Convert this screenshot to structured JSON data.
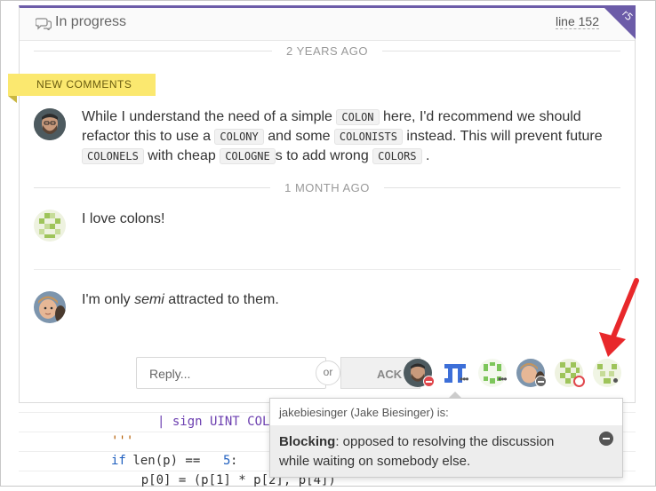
{
  "header": {
    "status": "In progress",
    "line_ref": "line 152",
    "corner": "r5",
    "status_icon": "speech-bubbles-icon"
  },
  "dividers": [
    "2 YEARS AGO",
    "1 MONTH AGO"
  ],
  "new_comments_label": "NEW COMMENTS",
  "comments": [
    {
      "avatar": "bearded-man-photo",
      "segments": {
        "t1": "While I understand the need of a simple ",
        "c1": "COLON",
        "t2": " here, I'd recommend we should refactor this to use a ",
        "c2": "COLONY",
        "t3": " and some ",
        "c3": "COLONISTS",
        "t4": " instead. This will prevent future ",
        "c4": "COLONELS",
        "t5": " with cheap ",
        "c5": "COLOGNE",
        "t6": "s to add wrong ",
        "c6": "COLORS",
        "t7": " ."
      }
    },
    {
      "avatar": "green-identicon",
      "text": "I love colons!"
    },
    {
      "avatar": "child-photo",
      "before": "I'm only ",
      "emph": "semi",
      "after": " attracted to them."
    }
  ],
  "reply": {
    "placeholder": "Reply...",
    "or": "or",
    "ack": "ACK"
  },
  "participants": [
    {
      "avatar": "bearded-man-photo",
      "status": "blocking"
    },
    {
      "avatar": "blue-identicon",
      "status": "pending"
    },
    {
      "avatar": "green-identicon",
      "status": "pending"
    },
    {
      "avatar": "child-photo",
      "status": "blocking-grey"
    },
    {
      "avatar": "green-checker-identicon",
      "status": "working"
    },
    {
      "avatar": "green-identicon-small",
      "status": "idle"
    }
  ],
  "tooltip": {
    "head": "jakebiesinger (Jake Biesinger) is:",
    "bold": "Blocking",
    "rest": ": opposed to resolving the discussion while waiting on somebody else."
  },
  "code": {
    "line1": "| sign UINT COL",
    "line2": "'''",
    "line3_kw": "if",
    "line3_rest": " len(p) == ",
    "line3_num": "5",
    "line3_end": ":",
    "line4": "    p[0] = (p[1] * p[2], p[4])"
  },
  "colors": {
    "accent": "#6c5ca8",
    "new_tag": "#fbe86f",
    "arrow": "#e8282b",
    "blocking": "#e0474c"
  }
}
